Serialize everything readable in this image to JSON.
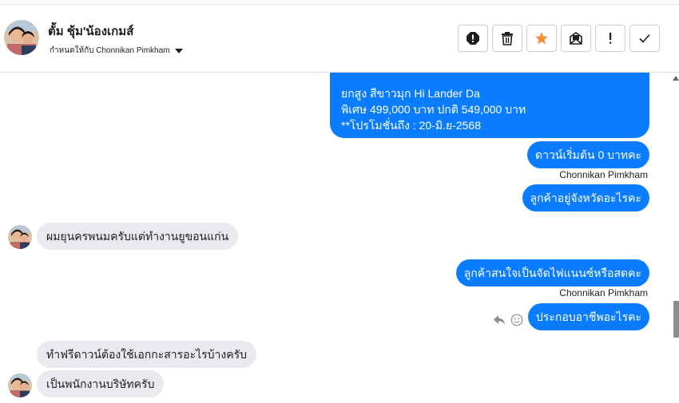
{
  "header": {
    "contact_name": "ตั้ม ชุ้ม'น้องเกมส์",
    "assigned_text": "กำหนดให้กับ Chonnikan Pimkham",
    "actions": [
      {
        "name": "report-icon"
      },
      {
        "name": "trash-icon"
      },
      {
        "name": "star-icon"
      },
      {
        "name": "mark-unread-icon"
      },
      {
        "name": "follow-up-icon"
      },
      {
        "name": "done-icon"
      }
    ],
    "star_color": "#f7923b"
  },
  "messages": {
    "promo_line1": "ยกสูง สีขาวมุก Hi Lander Da",
    "promo_line2": "พิเศษ 499,000 บาท  ปกติ 549,000 บาท",
    "promo_line3": "**โปรโมชั่นถึง : 20-มิ.ย-2568",
    "out1": "ดาวน์เริ่มต้น 0 บาทคะ",
    "sender1": "Chonnikan Pimkham",
    "out2": "ลูกค้าอยู่จังหวัดอะไรคะ",
    "in1": "ผมยุนครพนมครับแต่ทำงานยูขอนแก่น",
    "out3": "ลูกค้าสนใจเป็นจัดไฟแนนซ์หรือสดคะ",
    "sender2": "Chonnikan Pimkham",
    "out4": "ประกอบอาชีพอะไรคะ",
    "in2": "ทำฟรีดาวน์ต้องใช้เอกกะสารอะไรบ้างครับ",
    "in3": "เป็นพนักงานบริษัทครับ"
  },
  "colors": {
    "outgoing_bubble": "#0a7cff",
    "incoming_bubble": "#e9eaed"
  }
}
